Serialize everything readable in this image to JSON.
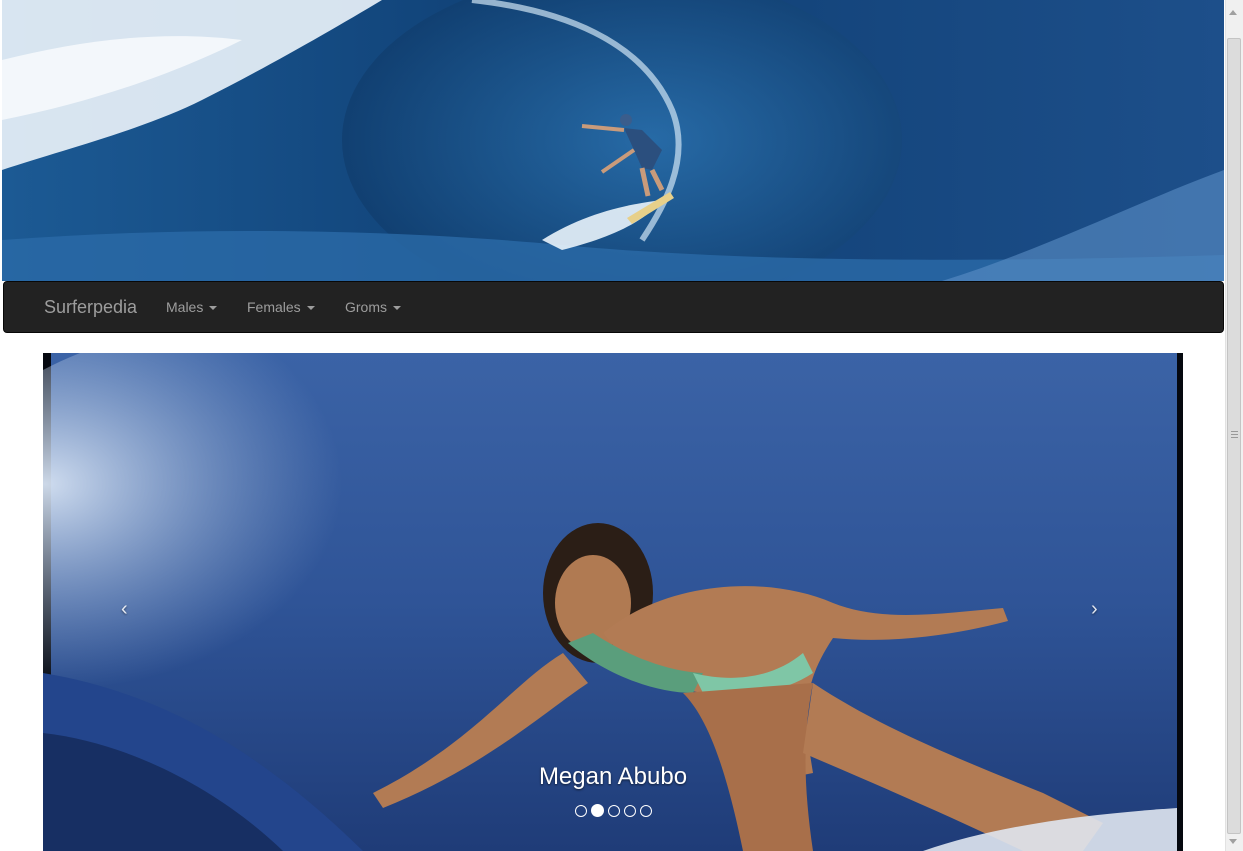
{
  "header": {
    "banner_image": "wave-surfer-banner"
  },
  "navbar": {
    "brand": "Surferpedia",
    "items": [
      {
        "label": "Males"
      },
      {
        "label": "Females"
      },
      {
        "label": "Groms"
      }
    ]
  },
  "carousel": {
    "caption": "Megan Abubo",
    "prev_icon": "chevron-left-icon",
    "next_icon": "chevron-right-icon",
    "prev_glyph": "‹",
    "next_glyph": "›",
    "slide_count": 5,
    "active_index": 1
  },
  "colors": {
    "navbar_bg": "#222222",
    "navbar_text": "#9d9d9d",
    "ocean_dark": "#16487c",
    "ocean_light": "#3f72b4"
  }
}
